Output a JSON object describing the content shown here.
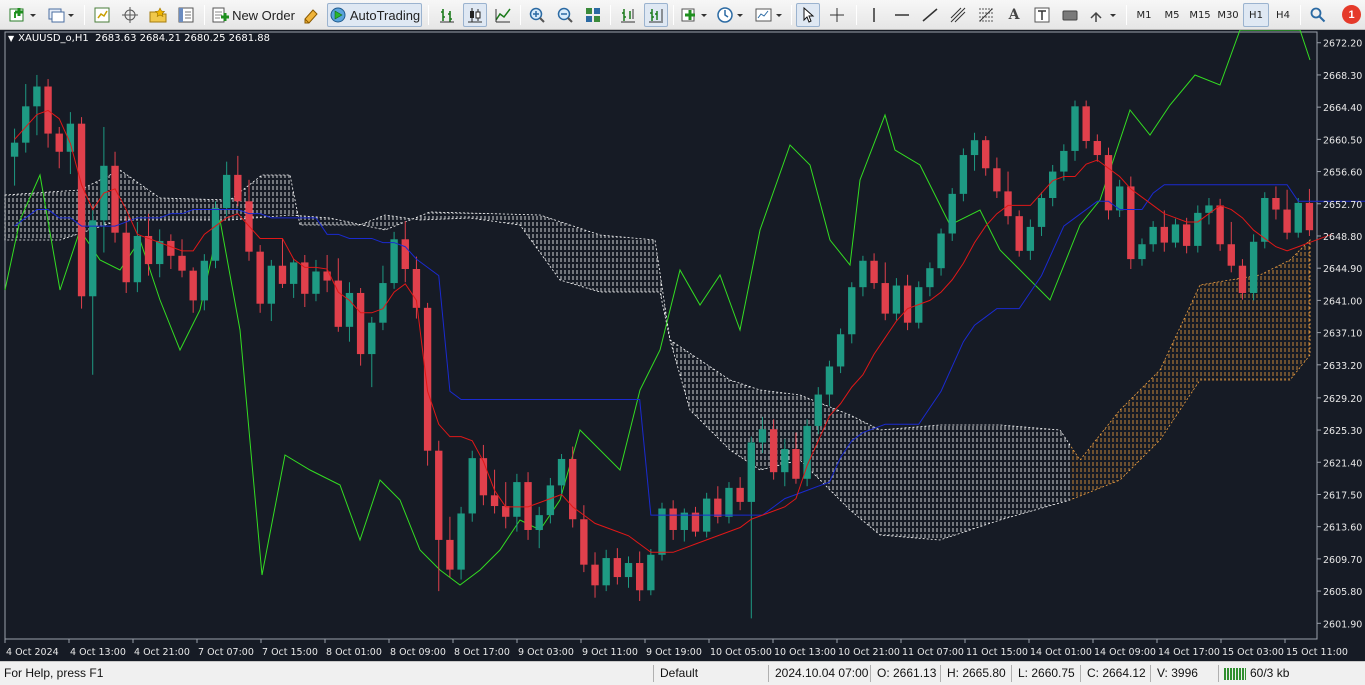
{
  "toolbar": {
    "new_order_label": "New Order",
    "autotrading_label": "AutoTrading",
    "periods": [
      "M1",
      "M5",
      "M15",
      "M30",
      "H1",
      "H4"
    ],
    "active_period": "H1",
    "notification_count": "1"
  },
  "chart": {
    "symbol_label": "XAUUSD_o,H1",
    "ohlc_label": "2683.63 2684.21 2680.25 2681.88",
    "background": "#161b25",
    "bull_color": "#1e9a83",
    "bear_color": "#e0404c",
    "price_axis_labels": [
      "2672.20",
      "2668.30",
      "2664.40",
      "2660.50",
      "2656.60",
      "2652.70",
      "2648.80",
      "2644.90",
      "2641.00",
      "2637.10",
      "2633.20",
      "2629.20",
      "2625.30",
      "2621.40",
      "2617.50",
      "2613.60",
      "2609.70",
      "2605.80",
      "2601.90"
    ],
    "time_axis_labels": [
      "4 Oct 2024",
      "4 Oct 13:00",
      "4 Oct 21:00",
      "7 Oct 07:00",
      "7 Oct 15:00",
      "8 Oct 01:00",
      "8 Oct 09:00",
      "8 Oct 17:00",
      "9 Oct 03:00",
      "9 Oct 11:00",
      "9 Oct 19:00",
      "10 Oct 05:00",
      "10 Oct 13:00",
      "10 Oct 21:00",
      "11 Oct 07:00",
      "11 Oct 15:00",
      "14 Oct 01:00",
      "14 Oct 09:00",
      "14 Oct 17:00",
      "15 Oct 03:00",
      "15 Oct 11:00"
    ]
  },
  "chart_data": {
    "type": "candlestick",
    "ylim": [
      2600.0,
      2673.5
    ],
    "indicator": "Ichimoku Kinko Hyo",
    "candles_ohlc": [
      [
        2658.4,
        2661.8,
        2654.9,
        2660.1
      ],
      [
        2660.1,
        2667.2,
        2658.9,
        2664.5
      ],
      [
        2664.5,
        2668.3,
        2661.0,
        2666.9
      ],
      [
        2666.9,
        2667.8,
        2659.5,
        2661.2
      ],
      [
        2661.2,
        2662.0,
        2657.0,
        2659.0
      ],
      [
        2659.0,
        2663.8,
        2656.3,
        2662.4
      ],
      [
        2662.4,
        2663.2,
        2640.0,
        2641.5
      ],
      [
        2641.5,
        2652.0,
        2632.0,
        2650.7
      ],
      [
        2650.7,
        2662.0,
        2646.8,
        2657.3
      ],
      [
        2657.3,
        2659.0,
        2648.0,
        2649.2
      ],
      [
        2649.2,
        2651.2,
        2641.9,
        2643.2
      ],
      [
        2643.2,
        2650.5,
        2642.0,
        2648.8
      ],
      [
        2648.8,
        2651.5,
        2644.0,
        2645.4
      ],
      [
        2645.4,
        2649.6,
        2643.8,
        2648.2
      ],
      [
        2648.2,
        2649.0,
        2644.8,
        2646.4
      ],
      [
        2646.4,
        2648.4,
        2643.8,
        2644.6
      ],
      [
        2644.6,
        2645.0,
        2639.5,
        2641.0
      ],
      [
        2641.0,
        2646.6,
        2639.8,
        2645.8
      ],
      [
        2645.8,
        2653.0,
        2644.9,
        2652.2
      ],
      [
        2652.2,
        2657.8,
        2651.2,
        2656.2
      ],
      [
        2656.2,
        2658.5,
        2652.4,
        2653.0
      ],
      [
        2653.0,
        2655.6,
        2645.8,
        2646.9
      ],
      [
        2646.9,
        2647.7,
        2639.5,
        2640.6
      ],
      [
        2640.6,
        2645.9,
        2638.5,
        2645.2
      ],
      [
        2645.2,
        2648.5,
        2642.5,
        2643.0
      ],
      [
        2643.0,
        2646.0,
        2641.3,
        2645.6
      ],
      [
        2645.6,
        2646.5,
        2640.2,
        2641.8
      ],
      [
        2641.8,
        2645.9,
        2640.9,
        2644.5
      ],
      [
        2644.5,
        2646.5,
        2642.0,
        2643.4
      ],
      [
        2643.4,
        2646.1,
        2637.2,
        2637.8
      ],
      [
        2637.8,
        2643.2,
        2636.0,
        2641.9
      ],
      [
        2641.9,
        2642.5,
        2633.1,
        2634.5
      ],
      [
        2634.5,
        2639.0,
        2630.5,
        2638.3
      ],
      [
        2638.3,
        2645.2,
        2637.4,
        2643.1
      ],
      [
        2643.1,
        2649.3,
        2642.4,
        2648.4
      ],
      [
        2648.4,
        2650.6,
        2643.2,
        2644.8
      ],
      [
        2644.8,
        2646.3,
        2638.8,
        2640.1
      ],
      [
        2640.1,
        2640.7,
        2621.0,
        2622.8
      ],
      [
        2622.8,
        2624.0,
        2605.8,
        2612.0
      ],
      [
        2612.0,
        2614.8,
        2607.5,
        2608.4
      ],
      [
        2608.4,
        2616.0,
        2607.2,
        2615.2
      ],
      [
        2615.2,
        2622.8,
        2614.2,
        2621.9
      ],
      [
        2621.9,
        2623.5,
        2616.2,
        2617.4
      ],
      [
        2617.4,
        2620.5,
        2615.2,
        2616.1
      ],
      [
        2616.1,
        2619.0,
        2613.4,
        2614.8
      ],
      [
        2614.8,
        2620.0,
        2613.0,
        2619.0
      ],
      [
        2619.0,
        2620.2,
        2612.0,
        2613.2
      ],
      [
        2613.2,
        2616.0,
        2611.0,
        2615.0
      ],
      [
        2615.0,
        2619.5,
        2614.0,
        2618.6
      ],
      [
        2618.6,
        2622.4,
        2617.3,
        2621.8
      ],
      [
        2621.8,
        2623.3,
        2613.5,
        2614.5
      ],
      [
        2614.5,
        2616.2,
        2608.1,
        2609.0
      ],
      [
        2609.0,
        2610.5,
        2605.0,
        2606.5
      ],
      [
        2606.5,
        2610.8,
        2605.8,
        2609.8
      ],
      [
        2609.8,
        2611.0,
        2606.6,
        2607.5
      ],
      [
        2607.5,
        2610.0,
        2606.2,
        2609.2
      ],
      [
        2609.2,
        2610.6,
        2604.6,
        2605.9
      ],
      [
        2605.9,
        2610.9,
        2605.3,
        2610.2
      ],
      [
        2610.2,
        2616.5,
        2609.5,
        2615.8
      ],
      [
        2615.8,
        2616.8,
        2612.0,
        2613.2
      ],
      [
        2613.2,
        2615.8,
        2611.8,
        2615.3
      ],
      [
        2615.3,
        2616.0,
        2612.4,
        2613.0
      ],
      [
        2613.0,
        2617.7,
        2612.3,
        2617.0
      ],
      [
        2617.0,
        2618.5,
        2614.0,
        2614.8
      ],
      [
        2614.8,
        2619.0,
        2614.0,
        2618.3
      ],
      [
        2618.3,
        2619.6,
        2615.6,
        2616.6
      ],
      [
        2616.6,
        2624.5,
        2602.5,
        2623.8
      ],
      [
        2623.8,
        2626.9,
        2622.5,
        2625.4
      ],
      [
        2625.4,
        2626.6,
        2619.3,
        2620.2
      ],
      [
        2620.2,
        2624.2,
        2618.5,
        2623.0
      ],
      [
        2623.0,
        2625.0,
        2618.8,
        2619.4
      ],
      [
        2619.4,
        2626.6,
        2618.5,
        2625.8
      ],
      [
        2625.8,
        2630.5,
        2624.8,
        2629.6
      ],
      [
        2629.6,
        2633.7,
        2628.2,
        2633.0
      ],
      [
        2633.0,
        2637.6,
        2632.2,
        2636.9
      ],
      [
        2636.9,
        2643.2,
        2635.8,
        2642.6
      ],
      [
        2642.6,
        2646.4,
        2641.5,
        2645.8
      ],
      [
        2645.8,
        2646.7,
        2642.4,
        2643.1
      ],
      [
        2643.1,
        2645.6,
        2638.6,
        2639.4
      ],
      [
        2639.4,
        2643.7,
        2638.6,
        2642.8
      ],
      [
        2642.8,
        2644.1,
        2637.4,
        2638.3
      ],
      [
        2638.3,
        2643.3,
        2637.6,
        2642.6
      ],
      [
        2642.6,
        2645.6,
        2641.5,
        2644.9
      ],
      [
        2644.9,
        2649.7,
        2644.0,
        2649.1
      ],
      [
        2649.1,
        2654.6,
        2648.2,
        2653.9
      ],
      [
        2653.9,
        2659.4,
        2653.0,
        2658.6
      ],
      [
        2658.6,
        2661.3,
        2656.7,
        2660.4
      ],
      [
        2660.4,
        2660.9,
        2656.1,
        2657.0
      ],
      [
        2657.0,
        2658.3,
        2653.4,
        2654.2
      ],
      [
        2654.2,
        2656.6,
        2650.2,
        2651.2
      ],
      [
        2651.2,
        2651.9,
        2646.3,
        2647.0
      ],
      [
        2647.0,
        2650.8,
        2645.9,
        2649.9
      ],
      [
        2649.9,
        2654.1,
        2648.8,
        2653.4
      ],
      [
        2653.4,
        2657.4,
        2652.4,
        2656.6
      ],
      [
        2656.6,
        2659.9,
        2655.5,
        2659.1
      ],
      [
        2659.1,
        2665.2,
        2657.9,
        2664.5
      ],
      [
        2664.5,
        2665.2,
        2659.4,
        2660.3
      ],
      [
        2660.3,
        2661.1,
        2657.8,
        2658.6
      ],
      [
        2658.6,
        2659.5,
        2650.8,
        2651.9
      ],
      [
        2651.9,
        2655.6,
        2651.1,
        2654.8
      ],
      [
        2654.8,
        2656.0,
        2644.8,
        2646.0
      ],
      [
        2646.0,
        2648.5,
        2645.2,
        2647.8
      ],
      [
        2647.8,
        2650.6,
        2646.9,
        2649.9
      ],
      [
        2649.9,
        2651.9,
        2646.9,
        2648.0
      ],
      [
        2648.0,
        2650.9,
        2647.4,
        2650.2
      ],
      [
        2650.2,
        2651.0,
        2646.7,
        2647.6
      ],
      [
        2647.6,
        2652.5,
        2646.8,
        2651.6
      ],
      [
        2651.6,
        2653.4,
        2650.2,
        2652.5
      ],
      [
        2652.5,
        2653.3,
        2647.0,
        2647.8
      ],
      [
        2647.8,
        2650.5,
        2644.4,
        2645.2
      ],
      [
        2645.2,
        2646.0,
        2641.1,
        2641.9
      ],
      [
        2641.9,
        2649.0,
        2641.0,
        2648.1
      ],
      [
        2648.1,
        2654.1,
        2647.3,
        2653.4
      ],
      [
        2653.4,
        2654.8,
        2650.8,
        2652.0
      ],
      [
        2652.0,
        2654.4,
        2648.4,
        2649.2
      ],
      [
        2649.2,
        2653.4,
        2648.6,
        2652.8
      ],
      [
        2652.8,
        2654.5,
        2648.8,
        2649.5
      ]
    ],
    "tenkan_sen": [
      2660.5,
      2662.0,
      2663.5,
      2664.0,
      2663.0,
      2660.0,
      2655.0,
      2652.0,
      2654.0,
      2654.5,
      2652.0,
      2649.0,
      2648.5,
      2648.0,
      2647.5,
      2647.0,
      2647.0,
      2649.0,
      2650.0,
      2651.0,
      2651.5,
      2650.0,
      2648.5,
      2648.5,
      2648.5,
      2646.0,
      2645.0,
      2645.0,
      2644.8,
      2642.0,
      2641.0,
      2639.5,
      2639.5,
      2640.0,
      2642.0,
      2643.0,
      2641.0,
      2630.0,
      2626.0,
      2624.5,
      2624.5,
      2624.0,
      2621.5,
      2618.0,
      2616.0,
      2616.0,
      2616.0,
      2616.5,
      2617.0,
      2617.5,
      2616.0,
      2615.0,
      2614.0,
      2613.5,
      2613.0,
      2612.5,
      2611.5,
      2610.5,
      2610.5,
      2610.5,
      2611.0,
      2611.5,
      2612.0,
      2612.5,
      2613.0,
      2613.5,
      2614.5,
      2615.0,
      2615.5,
      2616.0,
      2617.0,
      2621.0,
      2624.0,
      2627.0,
      2628.5,
      2630.5,
      2632.0,
      2634.5,
      2636.5,
      2638.5,
      2640.0,
      2640.5,
      2641.0,
      2642.0,
      2643.5,
      2645.5,
      2648.0,
      2650.0,
      2651.5,
      2652.5,
      2652.5,
      2652.5,
      2654.0,
      2655.5,
      2656.0,
      2656.0,
      2657.5,
      2658.0,
      2657.0,
      2656.0,
      2654.5,
      2653.5,
      2652.5,
      2651.5,
      2651.0,
      2650.5,
      2650.5,
      2651.5,
      2652.5,
      2652.0,
      2651.0,
      2649.5,
      2648.5,
      2647.5,
      2647.0,
      2647.5,
      2648.0,
      2648.5,
      2649.0
    ],
    "kijun_sen": [
      2650.0,
      2651.0,
      2652.0,
      2652.0,
      2651.0,
      2651.0,
      2650.0,
      2650.0,
      2650.0,
      2650.0,
      2650.5,
      2651.0,
      2651.0,
      2651.0,
      2651.5,
      2651.5,
      2652.0,
      2652.0,
      2652.0,
      2652.0,
      2652.0,
      2651.5,
      2651.5,
      2651.0,
      2651.0,
      2651.0,
      2651.0,
      2651.0,
      2649.0,
      2649.0,
      2648.5,
      2648.5,
      2648.5,
      2648.0,
      2648.0,
      2647.5,
      2646.0,
      2645.0,
      2644.0,
      2630.0,
      2629.0,
      2629.0,
      2629.0,
      2629.0,
      2629.0,
      2629.0,
      2629.0,
      2629.0,
      2629.0,
      2629.0,
      2629.0,
      2629.0,
      2629.0,
      2629.0,
      2629.0,
      2629.0,
      2629.0,
      2615.0,
      2615.0,
      2615.0,
      2615.0,
      2615.0,
      2615.0,
      2615.0,
      2615.0,
      2615.0,
      2615.0,
      2615.0,
      2616.0,
      2617.0,
      2617.5,
      2618.0,
      2618.5,
      2619.0,
      2622.0,
      2624.0,
      2625.0,
      2625.5,
      2626.0,
      2626.0,
      2626.0,
      2626.0,
      2628.0,
      2630.0,
      2633.0,
      2636.0,
      2638.0,
      2639.0,
      2640.0,
      2640.0,
      2640.0,
      2642.0,
      2644.0,
      2647.0,
      2650.0,
      2651.0,
      2652.0,
      2653.0,
      2653.0,
      2652.0,
      2652.0,
      2652.0,
      2654.0,
      2655.0,
      2655.0,
      2655.0,
      2655.0,
      2655.0,
      2655.0,
      2655.0,
      2655.0,
      2655.0,
      2655.0,
      2655.0,
      2655.0,
      2653.0,
      2653.0,
      2653.0,
      2653.0,
      2653.0,
      2653.0,
      2653.0
    ]
  },
  "statusbar": {
    "help_text": "For Help, press F1",
    "profile": "Default",
    "datetime": "2024.10.04 07:00",
    "open": "O: 2661.13",
    "high": "H: 2665.80",
    "low": "L: 2660.75",
    "close": "C: 2664.12",
    "volume": "V: 3996",
    "traffic": "60/3 kb"
  }
}
